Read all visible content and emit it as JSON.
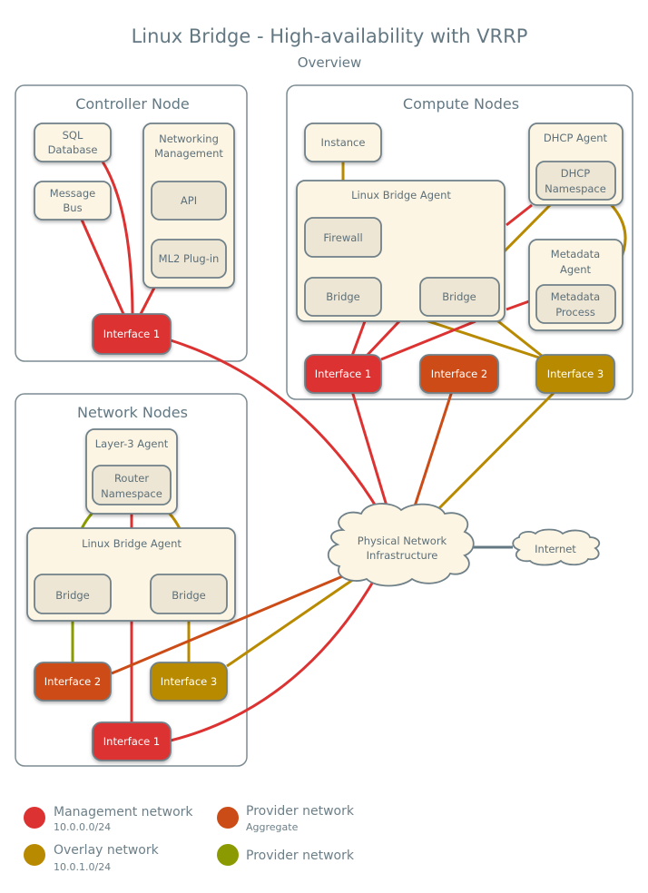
{
  "header": {
    "title": "Linux Bridge - High-availability with VRRP",
    "subtitle": "Overview"
  },
  "colors": {
    "management": "#dc3232",
    "provider_aggregate": "#cc4c17",
    "overlay": "#b88a00",
    "provider": "#8a9a00",
    "frame": "#7c8c94",
    "box_fill": "#fcf5e3",
    "inner_fill": "#ede6d5",
    "text": "#637883",
    "internet_link": "#637883"
  },
  "controller": {
    "title": "Controller Node",
    "sql_database": "SQL Database",
    "sql_line1": "SQL",
    "sql_line2": "Database",
    "message_bus_line1": "Message",
    "message_bus_line2": "Bus",
    "networking_mgmt_line1": "Networking",
    "networking_mgmt_line2": "Management",
    "api": "API",
    "ml2": "ML2 Plug-in",
    "interface1": "Interface 1"
  },
  "compute": {
    "title": "Compute Nodes",
    "instance": "Instance",
    "lba": "Linux Bridge Agent",
    "firewall": "Firewall",
    "bridge_left": "Bridge",
    "bridge_right": "Bridge",
    "dhcp_agent": "DHCP Agent",
    "dhcp_ns_line1": "DHCP",
    "dhcp_ns_line2": "Namespace",
    "metadata_agent_line1": "Metadata",
    "metadata_agent_line2": "Agent",
    "metadata_proc_line1": "Metadata",
    "metadata_proc_line2": "Process",
    "interface1": "Interface 1",
    "interface2": "Interface 2",
    "interface3": "Interface 3"
  },
  "network": {
    "title": "Network Nodes",
    "l3_agent": "Layer-3 Agent",
    "router_ns_line1": "Router",
    "router_ns_line2": "Namespace",
    "lba": "Linux Bridge Agent",
    "bridge_left": "Bridge",
    "bridge_right": "Bridge",
    "interface1": "Interface 1",
    "interface2": "Interface 2",
    "interface3": "Interface 3"
  },
  "clouds": {
    "physical_line1": "Physical Network",
    "physical_line2": "Infrastructure",
    "internet": "Internet"
  },
  "legend": [
    {
      "label": "Management network",
      "sub": "10.0.0.0/24",
      "color": "#dc3232"
    },
    {
      "label": "Provider network",
      "sub": "Aggregate",
      "color": "#cc4c17"
    },
    {
      "label": "Overlay network",
      "sub": "10.0.1.0/24",
      "color": "#b88a00"
    },
    {
      "label": "Provider network",
      "sub": "",
      "color": "#8a9a00"
    }
  ]
}
